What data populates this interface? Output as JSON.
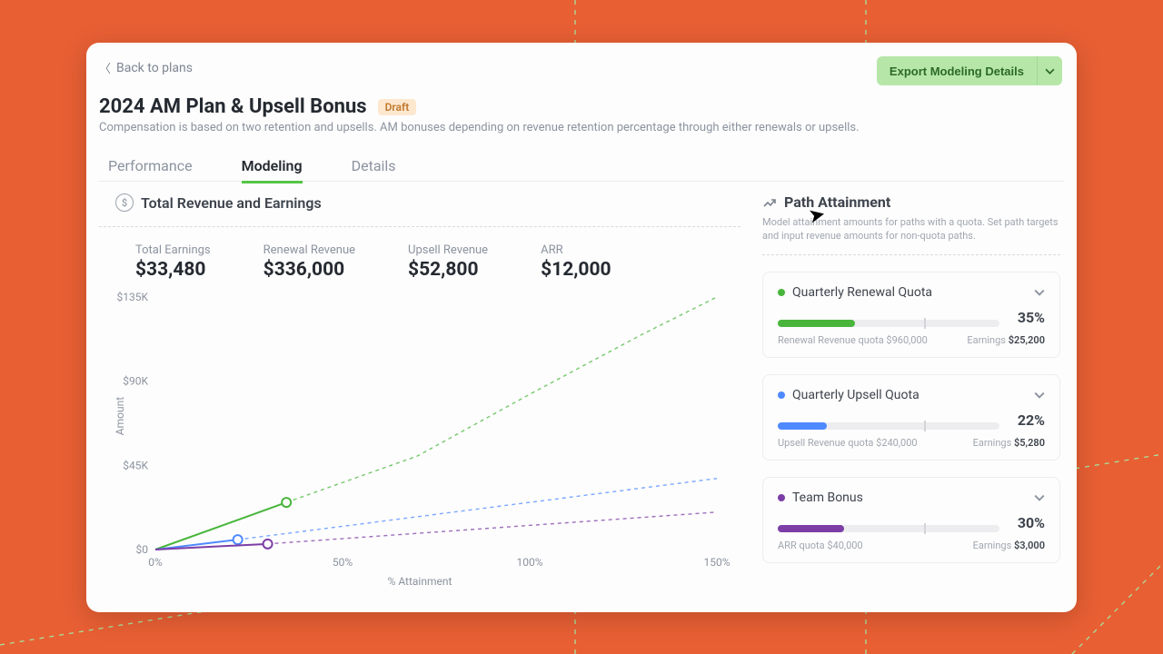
{
  "nav": {
    "back": "Back to plans"
  },
  "header": {
    "title": "2024 AM Plan & Upsell Bonus",
    "badge": "Draft",
    "subtitle": "Compensation is based on two retention and upsells. AM bonuses depending on revenue retention percentage through either renewals or upsells.",
    "export": "Export Modeling Details"
  },
  "tabs": {
    "performance": "Performance",
    "modeling": "Modeling",
    "details": "Details",
    "active": "modeling"
  },
  "revenue": {
    "title": "Total Revenue and Earnings",
    "kpis": {
      "total_earnings": {
        "label": "Total Earnings",
        "value": "$33,480"
      },
      "renewal_revenue": {
        "label": "Renewal Revenue",
        "value": "$336,000"
      },
      "upsell_revenue": {
        "label": "Upsell Revenue",
        "value": "$52,800"
      },
      "arr": {
        "label": "ARR",
        "value": "$12,000"
      }
    }
  },
  "chart_data": {
    "type": "line",
    "xlabel": "% Attainment",
    "ylabel": "Amount",
    "xlim": [
      0,
      150
    ],
    "ylim": [
      0,
      135000
    ],
    "xticks": [
      "0%",
      "50%",
      "100%",
      "150%"
    ],
    "yticks": [
      "$0",
      "$45K",
      "$90K",
      "$135K"
    ],
    "series": [
      {
        "name": "Quarterly Renewal Quota",
        "color": "#49b53c",
        "solid": [
          {
            "x": 0,
            "y": 0
          },
          {
            "x": 35,
            "y": 25200
          }
        ],
        "marker": {
          "x": 35,
          "y": 25200
        },
        "dashed": [
          {
            "x": 35,
            "y": 25200
          },
          {
            "x": 70,
            "y": 50000
          },
          {
            "x": 100,
            "y": 83000
          },
          {
            "x": 130,
            "y": 115000
          },
          {
            "x": 150,
            "y": 135000
          }
        ]
      },
      {
        "name": "Quarterly Upsell Quota",
        "color": "#4f89ff",
        "solid": [
          {
            "x": 0,
            "y": 0
          },
          {
            "x": 22,
            "y": 5280
          }
        ],
        "marker": {
          "x": 22,
          "y": 5280
        },
        "dashed": [
          {
            "x": 22,
            "y": 5280
          },
          {
            "x": 150,
            "y": 38000
          }
        ]
      },
      {
        "name": "Team Bonus",
        "color": "#7c3ea6",
        "solid": [
          {
            "x": 0,
            "y": 0
          },
          {
            "x": 30,
            "y": 3000
          }
        ],
        "marker": {
          "x": 30,
          "y": 3000
        },
        "dashed": [
          {
            "x": 30,
            "y": 3000
          },
          {
            "x": 150,
            "y": 20000
          }
        ]
      }
    ]
  },
  "path": {
    "title": "Path Attainment",
    "subtitle": "Model attainment amounts for paths with a quota. Set path targets and input revenue amounts for non-quota paths.",
    "cards": [
      {
        "key": "renewal",
        "name": "Quarterly Renewal Quota",
        "dot": "green",
        "pct": "35%",
        "pctv": 35,
        "mark": 66,
        "quota": "Renewal Revenue quota $960,000",
        "earn_lab": "Earnings ",
        "earn_val": "$25,200",
        "fill": "#49b53c"
      },
      {
        "key": "upsell",
        "name": "Quarterly Upsell Quota",
        "dot": "blue",
        "pct": "22%",
        "pctv": 22,
        "mark": 66,
        "quota": "Upsell Revenue quota $240,000",
        "earn_lab": "Earnings ",
        "earn_val": "$5,280",
        "fill": "#4f89ff"
      },
      {
        "key": "team",
        "name": "Team Bonus",
        "dot": "purple",
        "pct": "30%",
        "pctv": 30,
        "mark": 66,
        "quota": "ARR quota $40,000",
        "earn_lab": "Earnings ",
        "earn_val": "$3,000",
        "fill": "#7c3ea6"
      }
    ]
  }
}
